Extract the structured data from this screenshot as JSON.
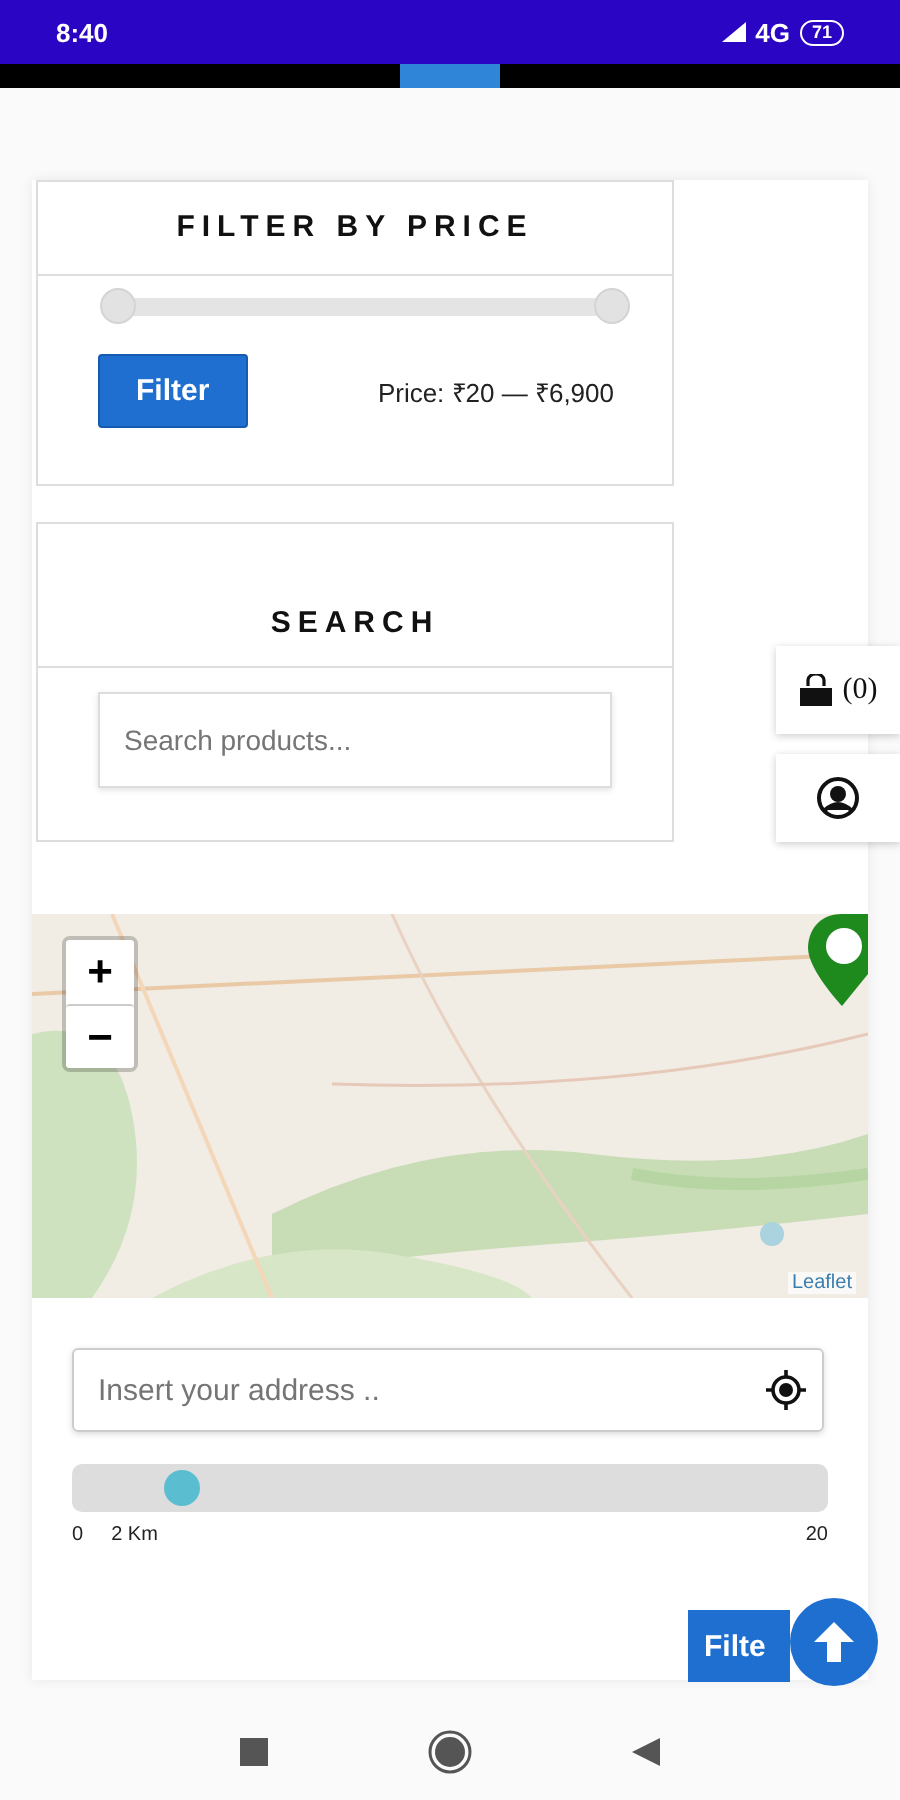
{
  "status_bar": {
    "time": "8:40",
    "network": "4G",
    "battery": "71"
  },
  "price_filter": {
    "title": "FILTER BY PRICE",
    "thumbs": [
      {
        "level": 0
      },
      {
        "level": 1
      }
    ],
    "button": "Filter",
    "price": "Price: ₹20 — ₹6,900"
  },
  "search": {
    "title": "SEARCH",
    "placeholder": "Search products..."
  },
  "side_actions": {
    "cart_count": "(0)"
  },
  "map": {
    "zoom_in": "+",
    "zoom_out": "−",
    "attribution": "Leaflet"
  },
  "address": {
    "placeholder": "Insert your address .."
  },
  "distance": {
    "level": 0.145,
    "min": "0",
    "value": "2 Km",
    "max": "20"
  },
  "filter_button": {
    "label": "Filte"
  }
}
